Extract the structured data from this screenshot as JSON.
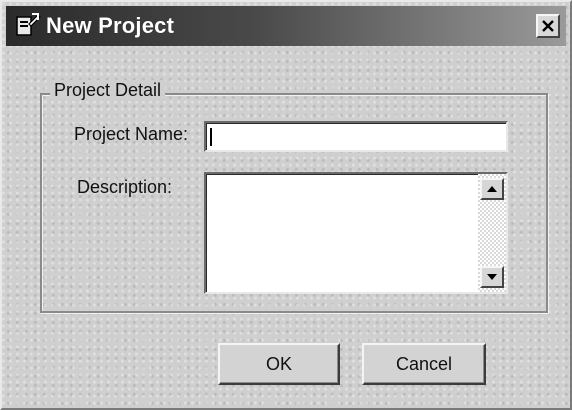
{
  "window": {
    "title": "New Project",
    "close_label": "X"
  },
  "group": {
    "legend": "Project Detail"
  },
  "fields": {
    "project_name_label": "Project Name:",
    "project_name_value": "",
    "description_label": "Description:",
    "description_value": ""
  },
  "buttons": {
    "ok_label": "OK",
    "cancel_label": "Cancel"
  },
  "icons": {
    "title": "new-project-icon",
    "close": "close-icon",
    "scroll_up": "arrow-up-icon",
    "scroll_down": "arrow-down-icon"
  },
  "colors": {
    "titlebar_start": "#2a2a2a",
    "titlebar_end": "#9a9a9a",
    "dialog_bg": "#cfcfcf",
    "field_bg": "#ffffff"
  }
}
